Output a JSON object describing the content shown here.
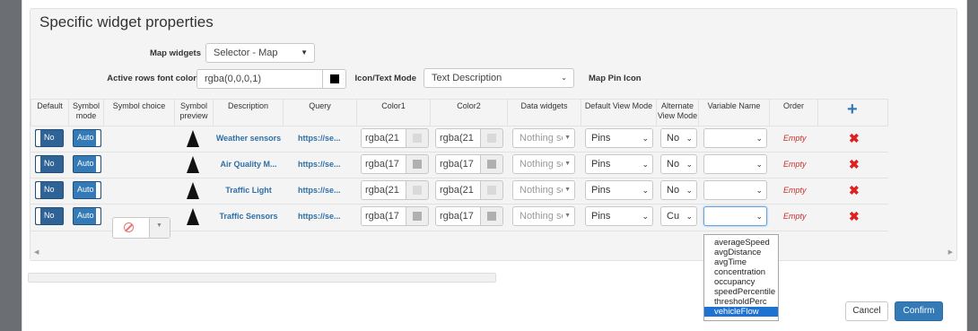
{
  "panel": {
    "title": "Specific widget properties"
  },
  "form": {
    "map_widgets_label": "Map widgets",
    "map_widgets_value": "Selector - Map",
    "font_color_label": "Active rows font color",
    "font_color_value": "rgba(0,0,0,1)",
    "icon_text_mode_label": "Icon/Text Mode",
    "icon_text_mode_value": "Text Description",
    "map_pin_icon_label": "Map Pin Icon"
  },
  "table": {
    "headers": [
      "Default",
      "Symbol mode",
      "Symbol choice",
      "Symbol preview",
      "Description",
      "Query",
      "Color1",
      "Color2",
      "Data widgets",
      "Default View Mode",
      "Alternate View Mode",
      "Variable Name",
      "Order"
    ],
    "rows": [
      {
        "default": "No",
        "symbol_mode": "Auto",
        "description": "Weather sensors",
        "query": "https://se...",
        "color1": "rgba(21",
        "color2": "rgba(21",
        "data_widgets": "Nothing se",
        "default_view": "Pins",
        "alt_view": "No",
        "variable": "",
        "order": "Empty"
      },
      {
        "default": "No",
        "symbol_mode": "Auto",
        "description": "Air Quality M...",
        "query": "https://se...",
        "color1": "rgba(17",
        "color2": "rgba(17",
        "data_widgets": "Nothing se",
        "default_view": "Pins",
        "alt_view": "No",
        "variable": "",
        "order": "Empty"
      },
      {
        "default": "No",
        "symbol_mode": "Auto",
        "description": "Traffic Light",
        "query": "https://se...",
        "color1": "rgba(21",
        "color2": "rgba(21",
        "data_widgets": "Nothing se",
        "default_view": "Pins",
        "alt_view": "No",
        "variable": "",
        "order": "Empty"
      },
      {
        "default": "No",
        "symbol_mode": "Auto",
        "description": "Traffic Sensors",
        "query": "https://se...",
        "color1": "rgba(17",
        "color2": "rgba(17",
        "data_widgets": "Nothing se",
        "default_view": "Pins",
        "alt_view": "Cu",
        "variable": "",
        "order": "Empty"
      }
    ],
    "swatch_colors": [
      "#d9d9d9",
      "#b0b0b0",
      "#d9d9d9",
      "#b0b0b0"
    ]
  },
  "variable_dropdown": {
    "options": [
      "averageSpeed",
      "avgDistance",
      "avgTime",
      "concentration",
      "occupancy",
      "speedPercentile",
      "thresholdPerc",
      "vehicleFlow"
    ],
    "highlighted": "vehicleFlow"
  },
  "footer": {
    "cancel_label": "Cancel",
    "confirm_label": "Confirm"
  },
  "icons": {
    "add": "plus-icon",
    "delete": "x-icon",
    "symbol_choice": "ban-icon",
    "preview": "arrow-up-icon"
  }
}
